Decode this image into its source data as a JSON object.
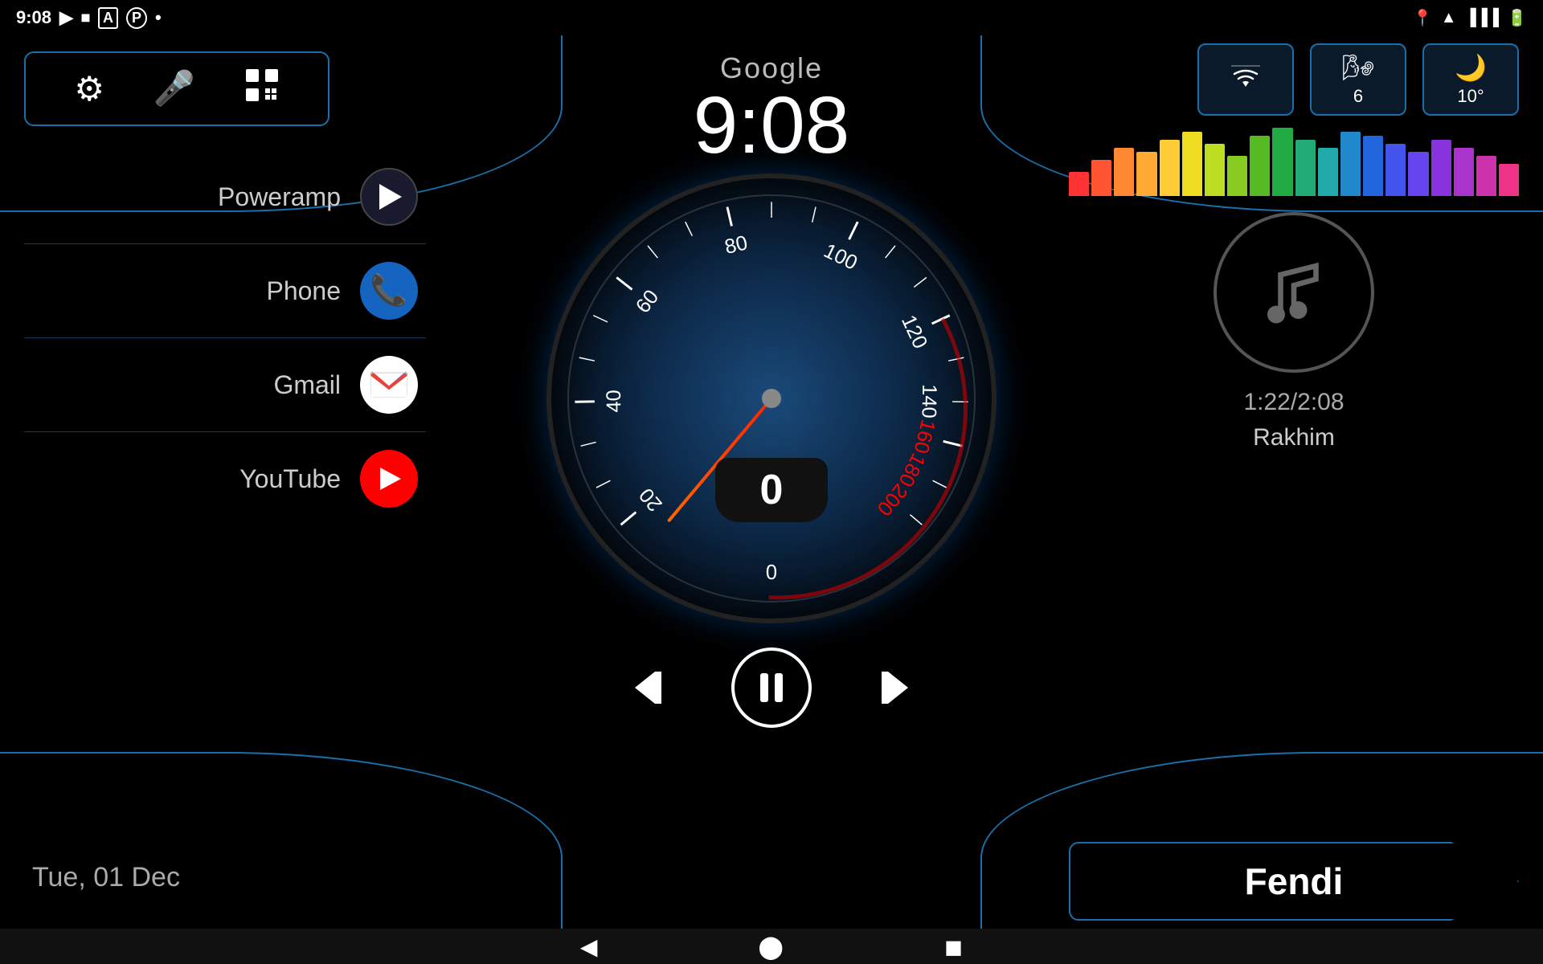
{
  "statusBar": {
    "time": "9:08",
    "rightIcons": [
      "location",
      "wifi-full",
      "signal-full",
      "battery-full"
    ]
  },
  "topBar": {
    "google": "Google",
    "time": "9:08"
  },
  "toolbar": {
    "settings_icon": "⚙",
    "mic_icon": "🎤",
    "apps_icon": "⊞"
  },
  "apps": [
    {
      "name": "Poweramp",
      "type": "poweramp"
    },
    {
      "name": "Phone",
      "type": "phone"
    },
    {
      "name": "Gmail",
      "type": "gmail"
    },
    {
      "name": "YouTube",
      "type": "youtube"
    }
  ],
  "date": "Tue, 01 Dec",
  "speedometer": {
    "speed": "0",
    "labels": [
      "20",
      "40",
      "60",
      "80",
      "100",
      "120",
      "140",
      "160",
      "180",
      "200"
    ]
  },
  "mediaControls": {
    "prev": "⏮",
    "pause": "⏸",
    "next": "⏭"
  },
  "rightPanel": {
    "wifi_label": "",
    "wifi_icon": "wifi",
    "wind_label": "6",
    "weather_label": "10°",
    "trackTime": "1:22/2:08",
    "artist": "Rakhim",
    "songTitle": "Fendi"
  },
  "navBar": {
    "back": "◀",
    "home": "⬤",
    "square": "◼"
  },
  "equalizer": {
    "colors": [
      "#ff3333",
      "#ff5533",
      "#ff8833",
      "#ffaa33",
      "#ffcc33",
      "#eedd22",
      "#bbdd22",
      "#88cc22",
      "#55bb22",
      "#22aa44",
      "#22aa77",
      "#22aaaa",
      "#2288cc",
      "#2266dd",
      "#4455ee",
      "#6644ee",
      "#8833dd",
      "#aa33cc",
      "#cc33aa",
      "#ee3388"
    ],
    "heights": [
      30,
      45,
      60,
      55,
      70,
      80,
      65,
      50,
      75,
      85,
      70,
      60,
      80,
      75,
      65,
      55,
      70,
      60,
      50,
      40
    ]
  }
}
